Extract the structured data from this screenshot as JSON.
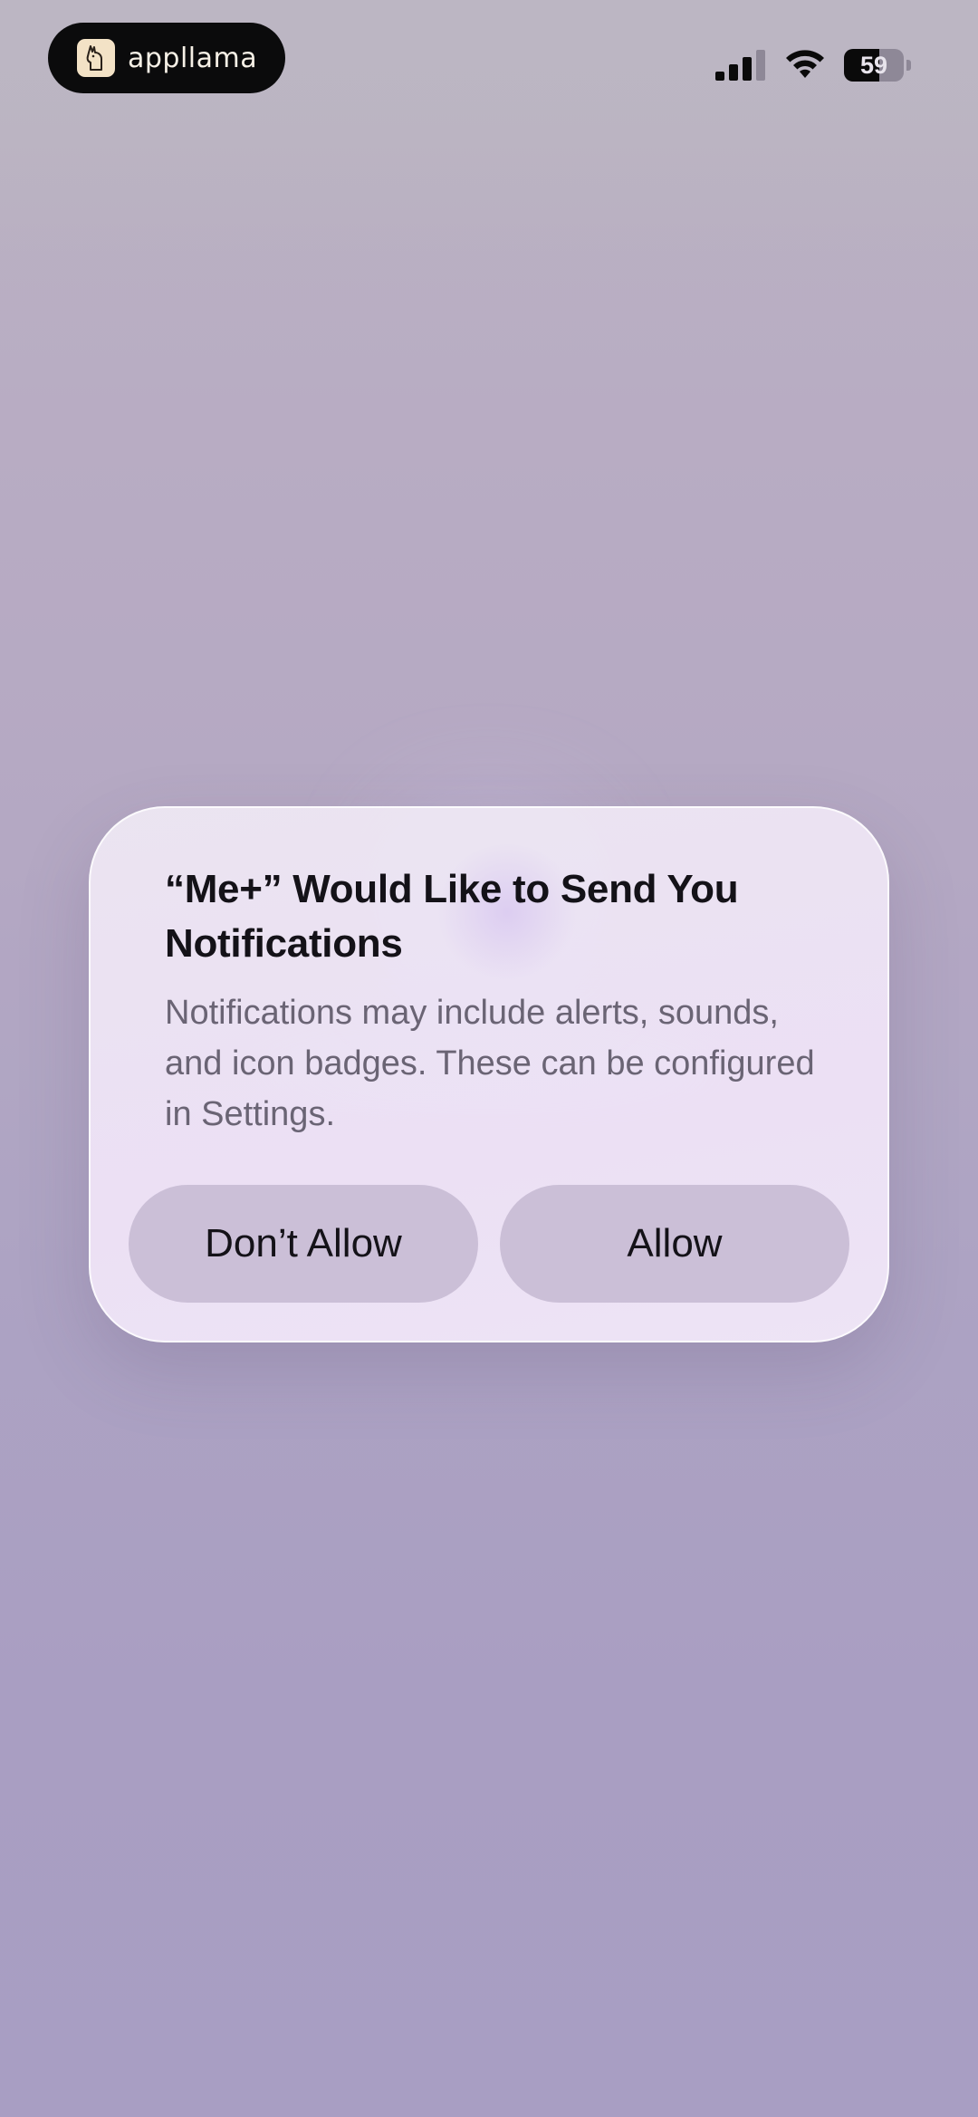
{
  "status_bar": {
    "app_badge": {
      "icon": "llama-icon",
      "brand": "appllama"
    },
    "cellular": {
      "icon": "cellular-signal-icon",
      "bars_filled": 3,
      "bars_total": 4
    },
    "wifi": {
      "icon": "wifi-icon"
    },
    "battery": {
      "icon": "battery-icon",
      "percent_label": "59",
      "level": 0.59
    }
  },
  "alert": {
    "title": "“Me+” Would Like to Send You Notifications",
    "message": "Notifications may include alerts, sounds, and icon badges. These can be configured in Settings.",
    "buttons": {
      "deny": "Don’t Allow",
      "allow": "Allow"
    }
  },
  "colors": {
    "button_fill": "#cbbfd7",
    "alert_fill": "#ece4f4",
    "title_text": "#141218",
    "message_text": "#6a6474"
  }
}
